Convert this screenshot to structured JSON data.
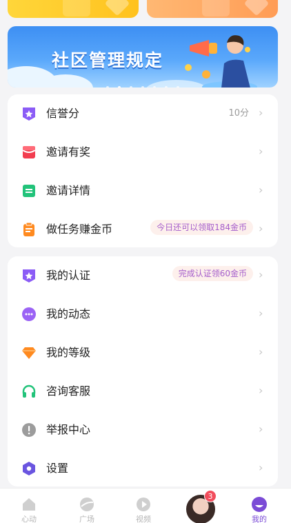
{
  "banner": {
    "title": "社区管理规定"
  },
  "menu1": [
    {
      "label": "信誉分",
      "value": "10分",
      "pill": ""
    },
    {
      "label": "邀请有奖",
      "value": "",
      "pill": ""
    },
    {
      "label": "邀请详情",
      "value": "",
      "pill": ""
    },
    {
      "label": "做任务赚金币",
      "value": "",
      "pill": "今日还可以领取184金币"
    }
  ],
  "menu2": [
    {
      "label": "我的认证",
      "pill": "完成认证领60金币"
    },
    {
      "label": "我的动态",
      "pill": ""
    },
    {
      "label": "我的等级",
      "pill": ""
    },
    {
      "label": "咨询客服",
      "pill": ""
    },
    {
      "label": "举报中心",
      "pill": ""
    },
    {
      "label": "设置",
      "pill": ""
    }
  ],
  "tabbar": {
    "tabs": [
      "心动",
      "广场",
      "视频",
      "",
      "我的"
    ],
    "badge": "3"
  },
  "colors": {
    "accent": "#7b4bd6",
    "pill_text": "#a55dcb",
    "pill_bg": "#fdf0ec"
  }
}
